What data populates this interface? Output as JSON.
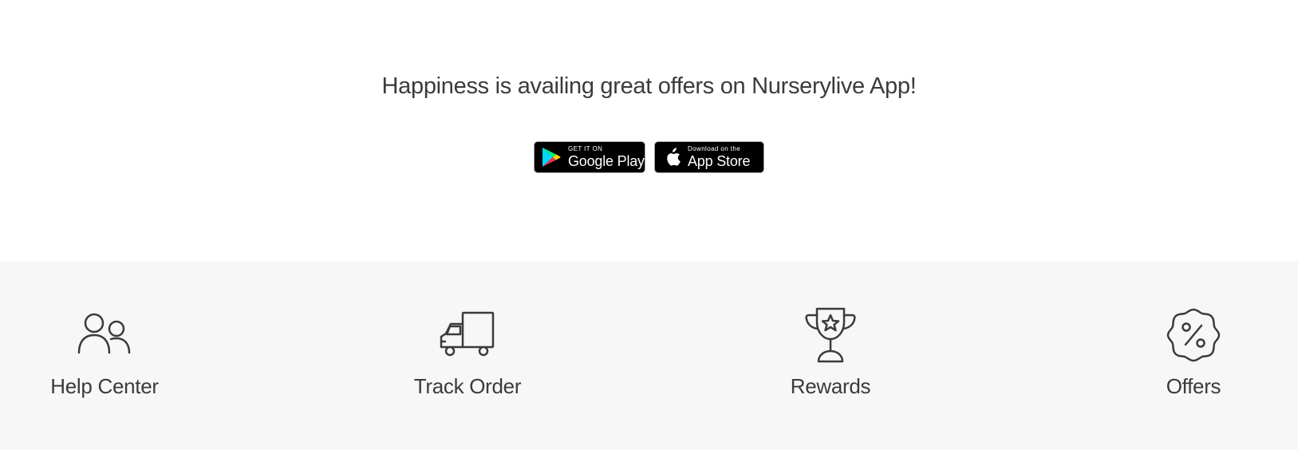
{
  "promo": {
    "title": "Happiness is availing great offers on Nurserylive App!",
    "google_play": {
      "small": "GET IT ON",
      "big": "Google Play"
    },
    "app_store": {
      "small": "Download on the",
      "big": "App Store"
    }
  },
  "services": {
    "help_center": {
      "label": "Help Center",
      "icon": "people-icon"
    },
    "track_order": {
      "label": "Track Order",
      "icon": "truck-icon"
    },
    "rewards": {
      "label": "Rewards",
      "icon": "trophy-icon"
    },
    "offers": {
      "label": "Offers",
      "icon": "percent-badge-icon"
    }
  },
  "colors": {
    "text": "#3b3b3b",
    "services_bg": "#f7f7f7",
    "badge_bg": "#000000"
  }
}
